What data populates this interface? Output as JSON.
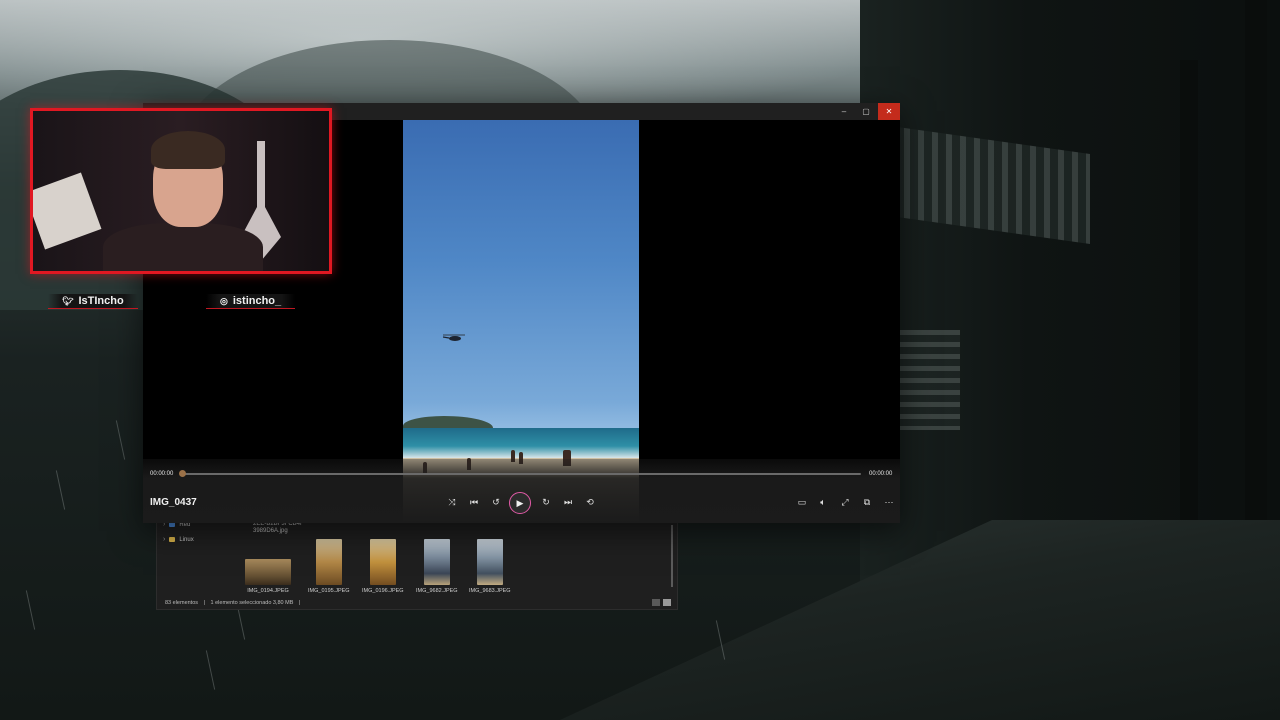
{
  "stream_overlay": {
    "twitter_handle": "IsTIncho",
    "instagram_handle": "istincho_",
    "accent_color": "#e01822"
  },
  "media_player": {
    "file_title": "IMG_0437",
    "time_elapsed": "00:00:00",
    "time_total": "00:00:00",
    "progress": 0,
    "window_controls": [
      "minimize",
      "maximize",
      "close"
    ],
    "transport": {
      "shuffle_icon": "shuffle-icon",
      "previous_icon": "previous-icon",
      "rewind_icon": "rewind-10-icon",
      "play_icon": "play-icon",
      "forward_icon": "forward-30-icon",
      "next_icon": "next-icon",
      "repeat_icon": "repeat-icon"
    },
    "right_controls": [
      "subtitles-icon",
      "volume-icon",
      "fullscreen-icon",
      "miniplayer-icon",
      "more-icon"
    ]
  },
  "file_explorer": {
    "tree": [
      {
        "label": "Red"
      },
      {
        "label": "Linux"
      }
    ],
    "partial_filename_line1": "2EE-B2BF3FCB4F",
    "partial_filename_line2": "3989D6A.jpg",
    "files": [
      {
        "name": "IMG_0194.JPEG"
      },
      {
        "name": "IMG_0195.JPEG"
      },
      {
        "name": "IMG_0196.JPEG"
      },
      {
        "name": "IMG_9682.JPEG"
      },
      {
        "name": "IMG_9683.JPEG"
      }
    ],
    "status_count": "83 elementos",
    "status_selected": "1 elemento seleccionado  3,80 MB"
  }
}
